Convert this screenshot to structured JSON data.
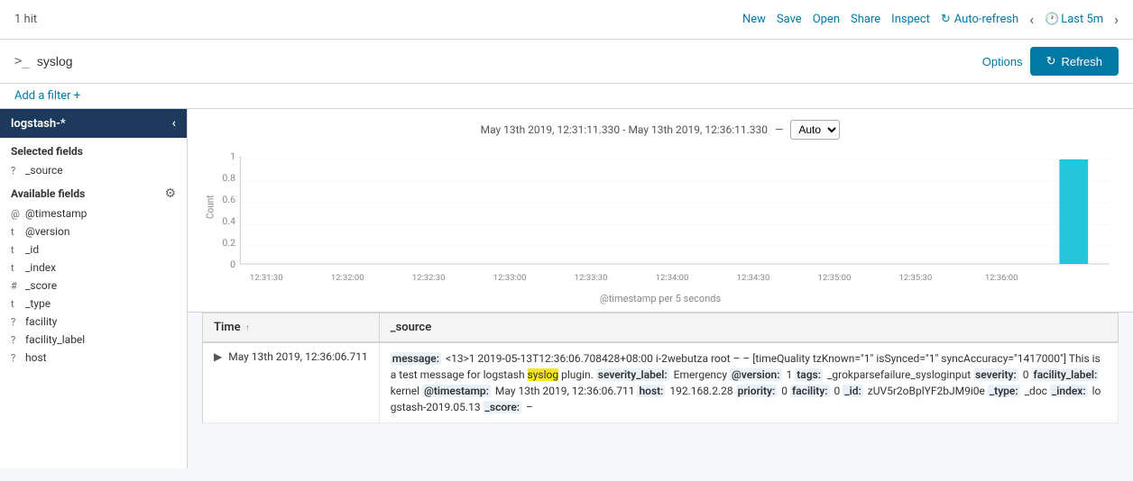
{
  "topnav": {
    "hits": "1 hit",
    "new": "New",
    "save": "Save",
    "open": "Open",
    "share": "Share",
    "inspect": "Inspect",
    "auto_refresh": "Auto-refresh",
    "last_time": "Last 5m"
  },
  "searchbar": {
    "icon": ">_",
    "query": "syslog",
    "options_label": "Options",
    "refresh_label": "Refresh"
  },
  "filter": {
    "add_label": "Add a filter +"
  },
  "sidebar": {
    "index": "logstash-*",
    "selected_fields_title": "Selected fields",
    "selected_fields": [
      {
        "type": "?",
        "name": "_source"
      }
    ],
    "available_fields_title": "Available fields",
    "available_fields": [
      {
        "type": "@",
        "name": "@timestamp"
      },
      {
        "type": "t",
        "name": "@version"
      },
      {
        "type": "t",
        "name": "_id"
      },
      {
        "type": "t",
        "name": "_index"
      },
      {
        "type": "#",
        "name": "_score"
      },
      {
        "type": "t",
        "name": "_type"
      },
      {
        "type": "?",
        "name": "facility"
      },
      {
        "type": "?",
        "name": "facility_label"
      },
      {
        "type": "?",
        "name": "host"
      }
    ]
  },
  "chart": {
    "time_range": "May 13th 2019, 12:31:11.330 - May 13th 2019, 12:36:11.330",
    "separator": "—",
    "auto_option": "Auto",
    "x_label": "@timestamp per 5 seconds",
    "y_axis": [
      "1",
      "0.8",
      "0.6",
      "0.4",
      "0.2",
      "0"
    ],
    "x_ticks": [
      "12:31:30",
      "12:32:00",
      "12:32:30",
      "12:33:00",
      "12:33:30",
      "12:34:00",
      "12:34:30",
      "12:35:00",
      "12:35:30",
      "12:36:00"
    ],
    "y_label": "Count"
  },
  "results": {
    "table_headers": [
      "Time",
      "_source"
    ],
    "rows": [
      {
        "time": "May 13th 2019, 12:36:06.711",
        "source": "message: <13>1 2019-05-13T12:36:06.708428+08:00 i-2webutza root – – [timeQuality tzKnown=\"1\" isSynced=\"1\" syncAccuracy=\"1417000\"] This is a test message for logstash syslog plugin. severity_label: Emergency @version: 1 tags: _grokparsefailure_sysloginput severity: 0 facility_label: kernel @timestamp: May 13th 2019, 12:36:06.711 host: 192.168.2.28 priority: 0 facility: 0 _id: zUV5r2oBplYF2bJM9i0e _type: _doc _index: logstash-2019.05.13 _score: –"
      }
    ]
  }
}
